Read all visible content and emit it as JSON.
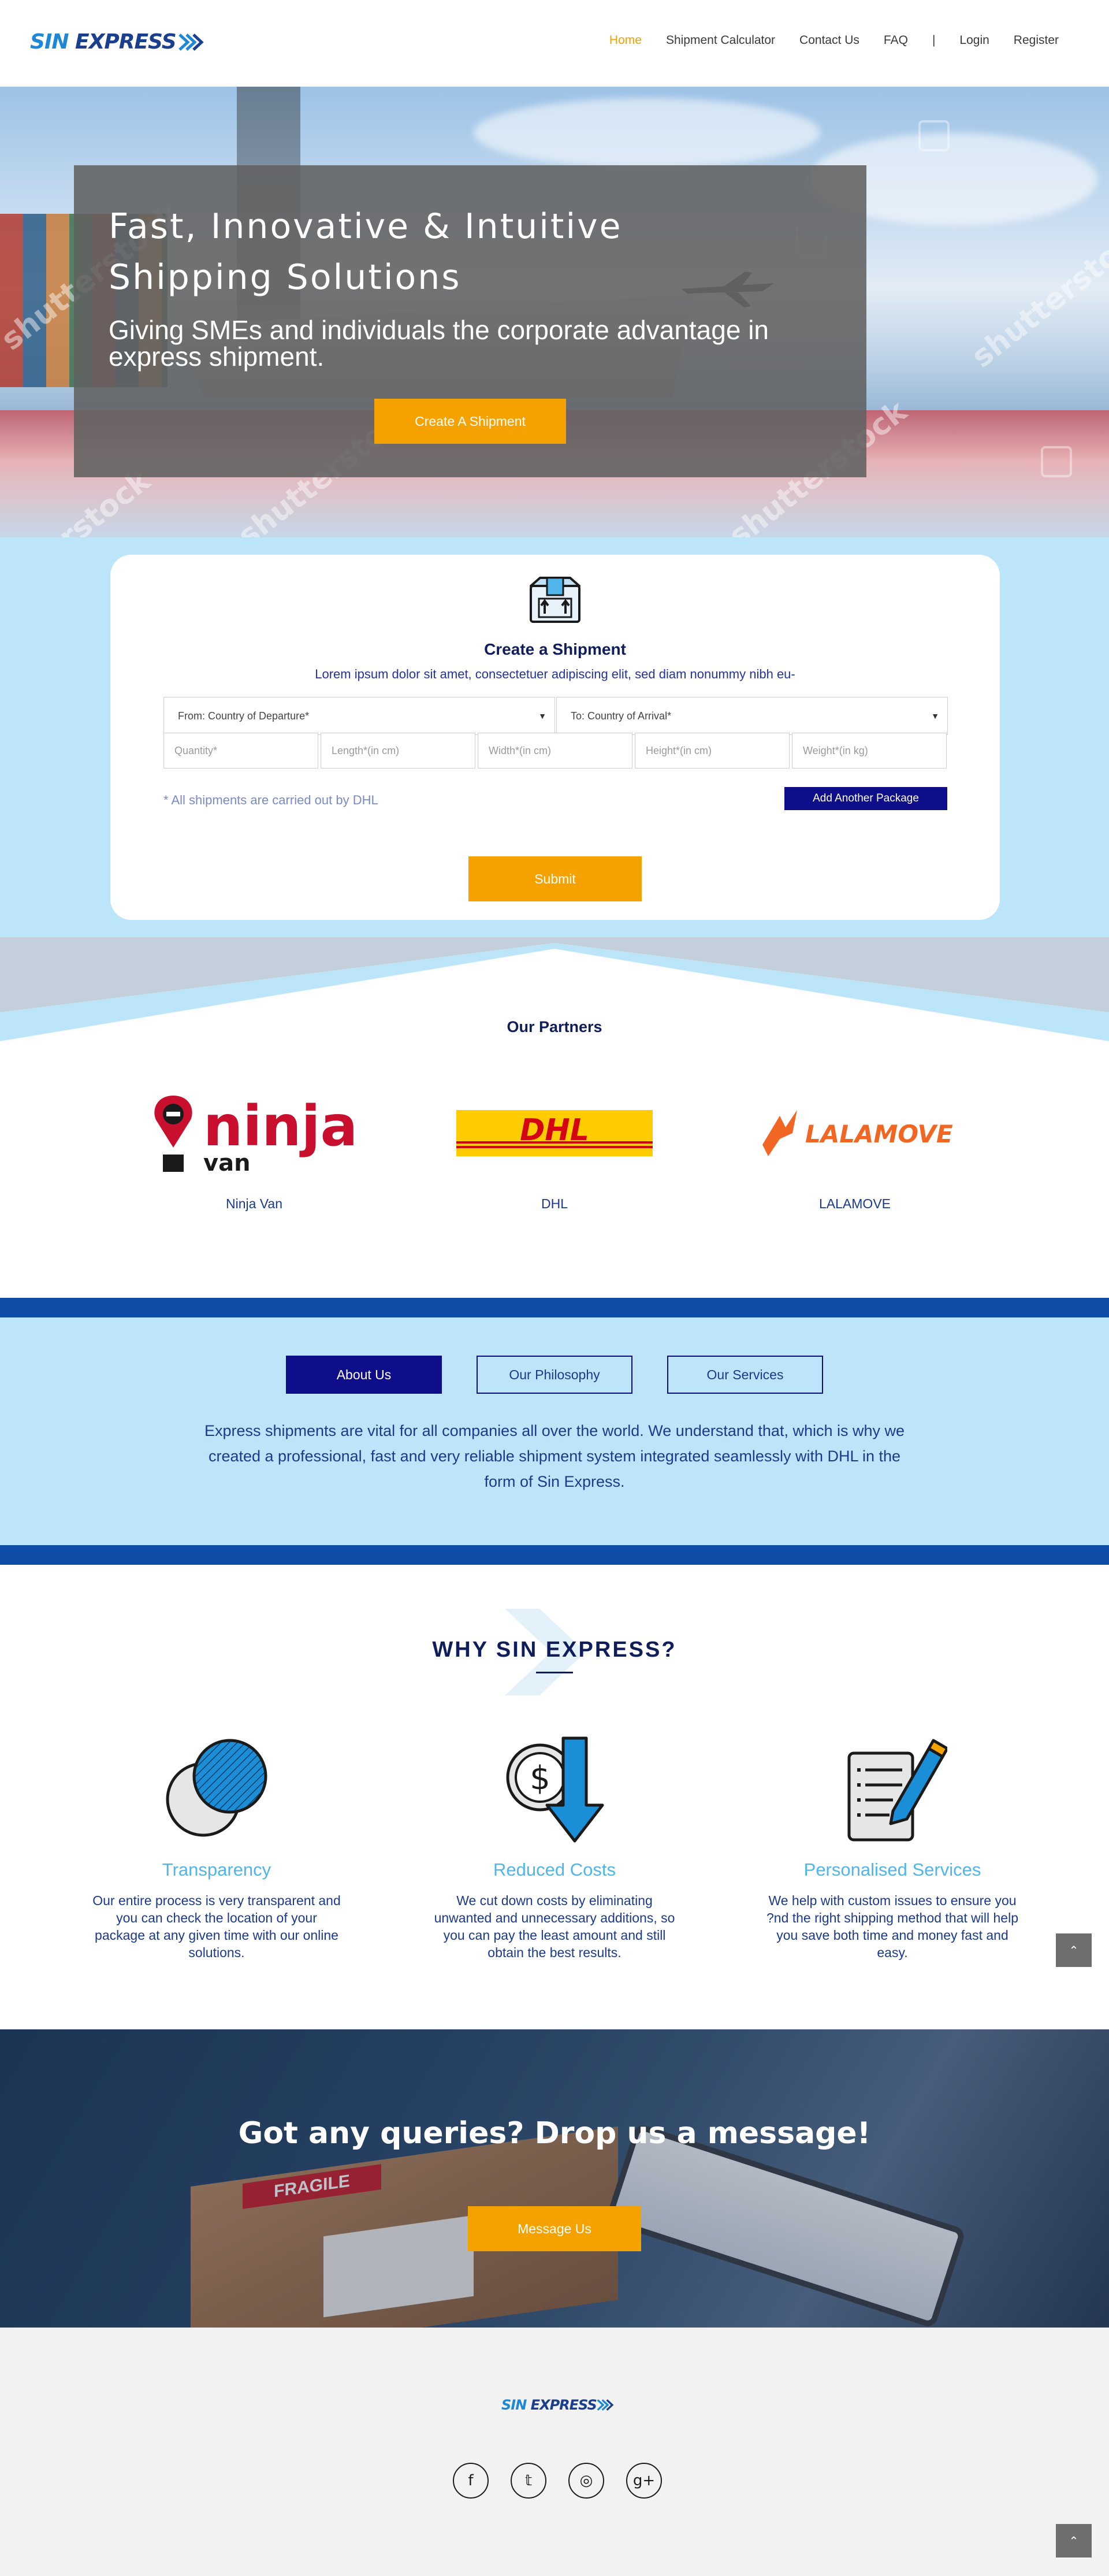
{
  "brand": {
    "name_part1": "SIN",
    "name_part2": "EXPRESS",
    "primary_color": "#1e88d6",
    "accent_color": "#f5a100",
    "navy_color": "#0e0e8a"
  },
  "nav": {
    "items": [
      {
        "label": "Home",
        "active": true
      },
      {
        "label": "Shipment Calculator",
        "active": false
      },
      {
        "label": "Contact Us",
        "active": false
      },
      {
        "label": "FAQ",
        "active": false
      },
      {
        "label": "|",
        "active": false
      },
      {
        "label": "Login",
        "active": false
      },
      {
        "label": "Register",
        "active": false
      }
    ]
  },
  "hero": {
    "title_line1": "Fast, Innovative & Intuitive",
    "title_line2": "Shipping Solutions",
    "subtitle": "Giving SMEs and individuals the corporate advantage in express shipment.",
    "cta_label": "Create A Shipment",
    "watermark": "shutterstock"
  },
  "shipment_form": {
    "title": "Create a Shipment",
    "description": "Lorem ipsum dolor sit amet, consectetuer adipiscing elit, sed diam nonummy nibh eu-",
    "from_select": "From: Country of Departure*",
    "to_select": "To: Country of Arrival*",
    "fields": {
      "quantity": "Quantity*",
      "length": "Length*(in cm)",
      "width": "Width*(in cm)",
      "height": "Height*(in cm)",
      "weight": "Weight*(in kg)"
    },
    "note": "* All shipments are carried out by DHL",
    "add_package_label": "Add Another Package",
    "submit_label": "Submit"
  },
  "partners": {
    "title": "Our Partners",
    "items": [
      {
        "name": "Ninja Van",
        "logo_word": "ninja",
        "logo_sub": "van"
      },
      {
        "name": "DHL",
        "logo_word": "DHL"
      },
      {
        "name": "LALAMOVE",
        "logo_word": "LALAMOVE"
      }
    ]
  },
  "about": {
    "tabs": [
      {
        "label": "About Us",
        "active": true
      },
      {
        "label": "Our Philosophy",
        "active": false
      },
      {
        "label": "Our Services",
        "active": false
      }
    ],
    "text": "Express shipments are vital for all companies all over the world. We understand that, which is why we created a professional, fast and very reliable shipment system integrated seamlessly with DHL in the form of Sin Express."
  },
  "why": {
    "title": "WHY SIN EXPRESS?",
    "features": [
      {
        "title": "Transparency",
        "text": "Our entire process is very transparent and you can check the location of your package at any given time with our online solutions.",
        "icon": "overlapping-circles-icon"
      },
      {
        "title": "Reduced Costs",
        "text": "We cut down costs by eliminating unwanted and unnecessary additions, so you can pay the least amount and still obtain the best results.",
        "icon": "dollar-down-arrow-icon"
      },
      {
        "title": "Personalised Services",
        "text": "We help with custom issues to ensure you ?nd the right shipping method that will help you save both time and money fast and easy.",
        "icon": "document-pencil-icon"
      }
    ]
  },
  "message": {
    "title": "Got any queries? Drop us a message!",
    "button_label": "Message Us",
    "fragile_text": "FRAGILE"
  },
  "footer": {
    "socials": [
      {
        "name": "facebook",
        "glyph": "f"
      },
      {
        "name": "twitter",
        "glyph": "𝕥"
      },
      {
        "name": "instagram",
        "glyph": "◎"
      },
      {
        "name": "google-plus",
        "glyph": "g+"
      }
    ]
  },
  "scroll_top_glyph": "⌃"
}
